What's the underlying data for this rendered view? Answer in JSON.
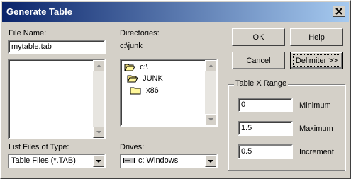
{
  "window": {
    "title": "Generate Table"
  },
  "file_name": {
    "label": "File Name:",
    "value": "mytable.tab"
  },
  "file_types": {
    "label": "List Files of Type:",
    "selected": "Table Files (*.TAB)"
  },
  "directories": {
    "label": "Directories:",
    "current_path": "c:\\junk",
    "tree": [
      {
        "label": "c:\\"
      },
      {
        "label": "JUNK"
      },
      {
        "label": "x86"
      }
    ]
  },
  "drives": {
    "label": "Drives:",
    "selected": "c: Windows"
  },
  "buttons": {
    "ok": "OK",
    "help": "Help",
    "cancel": "Cancel",
    "delimiter": "Delimiter >>"
  },
  "range": {
    "label": "Table X Range",
    "minimum": {
      "label": "Minimum",
      "value": "0"
    },
    "maximum": {
      "label": "Maximum",
      "value": "1.5"
    },
    "increment": {
      "label": "Increment",
      "value": "0.5"
    }
  }
}
